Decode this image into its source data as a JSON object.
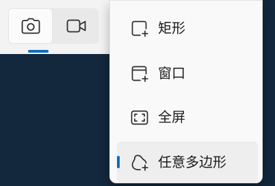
{
  "toolbar": {
    "modes": [
      {
        "id": "photo",
        "icon": "camera-icon",
        "active": true
      },
      {
        "id": "video",
        "icon": "video-camera-icon",
        "active": false
      }
    ]
  },
  "menu": {
    "items": [
      {
        "label": "矩形",
        "icon": "rectangle-snip-icon",
        "selected": false
      },
      {
        "label": "窗口",
        "icon": "window-snip-icon",
        "selected": false
      },
      {
        "label": "全屏",
        "icon": "fullscreen-snip-icon",
        "selected": false
      },
      {
        "label": "任意多边形",
        "icon": "freeform-snip-icon",
        "selected": true
      }
    ]
  },
  "colors": {
    "accent": "#0f6cbd",
    "background": "#13283d",
    "surface": "#f9f9f9"
  }
}
